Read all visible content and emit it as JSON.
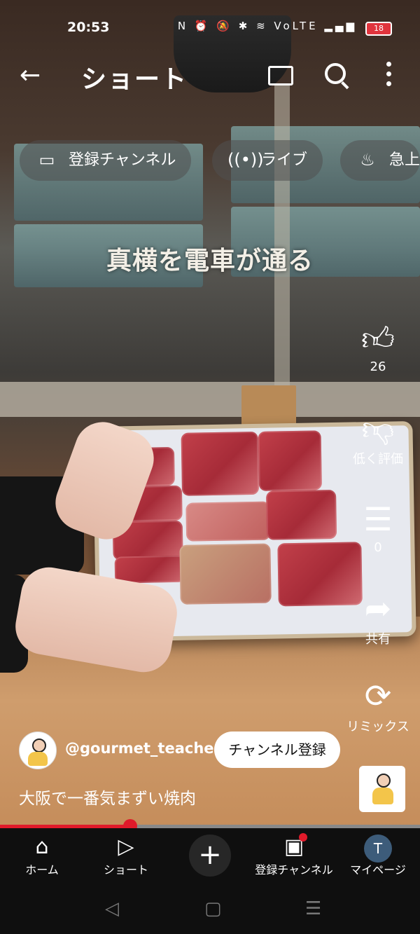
{
  "status_bar": {
    "time": "20:53",
    "icons": "N ⏰ 🔕 ✱ ≋ VoLTE ▂▄▆",
    "battery": "18"
  },
  "header": {
    "back_icon": "arrow-left-icon",
    "title": "ショート"
  },
  "chips": [
    {
      "label": "登録チャンネル",
      "icon": "subscriptions-icon"
    },
    {
      "label": "ライブ",
      "icon": "live-icon"
    },
    {
      "label": "急上",
      "icon": "trending-icon"
    }
  ],
  "video": {
    "caption": "真横を電車が通る"
  },
  "actions": {
    "like": {
      "icon": "thumbs-up-icon",
      "count": "26"
    },
    "dislike": {
      "icon": "thumbs-down-icon",
      "label": "低く評価"
    },
    "comments": {
      "icon": "comment-icon",
      "count": "0"
    },
    "share": {
      "icon": "share-icon",
      "label": "共有"
    },
    "remix": {
      "icon": "remix-icon",
      "label": "リミックス"
    }
  },
  "channel": {
    "handle": "@gourmet_teacher",
    "subscribe_label": "チャンネル登録"
  },
  "description": "大阪で一番気まずい焼肉",
  "progress": {
    "fraction": 0.31
  },
  "bottom_nav": [
    {
      "label": "ホーム",
      "icon": "home-icon"
    },
    {
      "label": "ショート",
      "icon": "shorts-icon"
    },
    {
      "label": "",
      "icon": "plus-icon"
    },
    {
      "label": "登録チャンネル",
      "icon": "subscriptions-icon"
    },
    {
      "label": "マイページ",
      "icon": "avatar-icon",
      "avatar_letter": "T"
    }
  ],
  "colors": {
    "accent": "#e01a2a",
    "nav_bg": "#0f0f0f"
  }
}
